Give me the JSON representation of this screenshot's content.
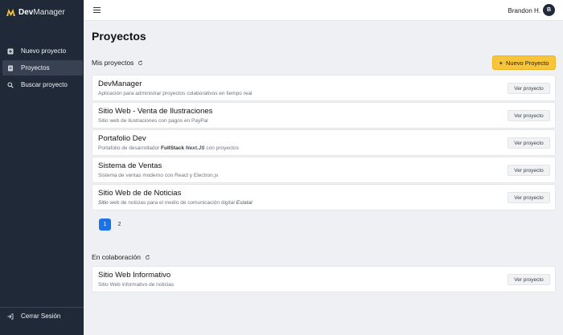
{
  "brand": {
    "name_bold": "Dev",
    "name_light": "Manager"
  },
  "sidebar": {
    "items": [
      {
        "label": "Nuevo proyecto",
        "icon": "plus-square-icon"
      },
      {
        "label": "Proyectos",
        "icon": "document-icon"
      },
      {
        "label": "Buscar proyecto",
        "icon": "search-icon"
      }
    ],
    "logout": {
      "label": "Cerrar Sesión",
      "icon": "logout-icon"
    }
  },
  "header": {
    "user_name": "Brandon H.",
    "avatar_initial": "B"
  },
  "main": {
    "title": "Proyectos",
    "my_projects": {
      "heading": "Mis proyectos",
      "new_button": "Nuevo Proyecto",
      "items": [
        {
          "title": "DevManager",
          "description": "Aplicación para administrar proyectos colaborativos en tiempo real",
          "button": "Ver proyecto"
        },
        {
          "title": "Sitio Web - Venta de Ilustraciones",
          "description": "Sitio web de ilustraciones con pagos en PayPal",
          "button": "Ver proyecto"
        },
        {
          "title": "Portafolio Dev",
          "desc_prefix": "Portafolio de desarrollador ",
          "desc_bold": "FullStack",
          "desc_italic": "Next.JS",
          "desc_suffix": " con proyectos",
          "button": "Ver proyecto"
        },
        {
          "title": "Sistema de Ventas",
          "description": "Sistema de ventas moderno con React y Electron.js",
          "button": "Ver proyecto"
        },
        {
          "title": "Sitio Web de de Noticias",
          "desc_italic_a": "Sitio",
          "desc_mid": " web de noticias para el medio de comunicación digital ",
          "desc_italic_b": "Estatal",
          "button": "Ver proyecto"
        }
      ]
    },
    "pagination": {
      "pages": [
        "1",
        "2"
      ],
      "current": "1"
    },
    "collab": {
      "heading": "En colaboración",
      "items": [
        {
          "title": "Sitio Web Informativo",
          "description": "Sitio Web informativo de noticias",
          "button": "Ver proyecto"
        }
      ]
    }
  },
  "colors": {
    "sidebar_bg": "#1f2937",
    "accent": "#f8c53a",
    "page_active": "#1a73e8",
    "background": "#eef0f4"
  }
}
